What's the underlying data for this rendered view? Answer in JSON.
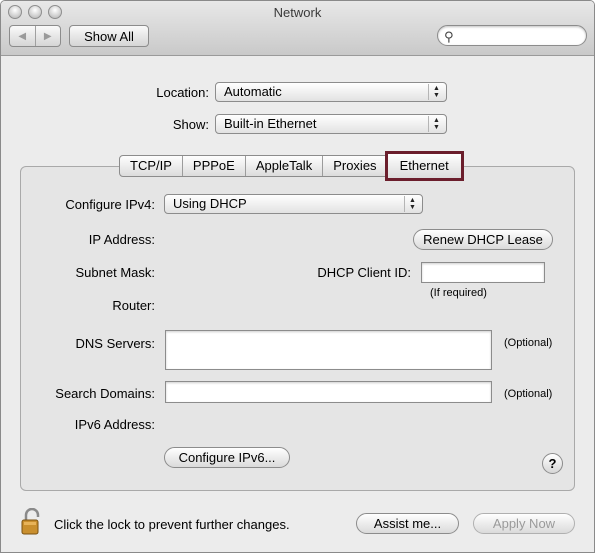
{
  "window": {
    "title": "Network"
  },
  "toolbar": {
    "show_all_label": "Show All",
    "search_placeholder": "",
    "back_glyph": "◀",
    "forward_glyph": "▶",
    "search_glyph": "⚲"
  },
  "location": {
    "label": "Location:",
    "value": "Automatic"
  },
  "show": {
    "label": "Show:",
    "value": "Built-in Ethernet"
  },
  "tabs": [
    {
      "label": "TCP/IP"
    },
    {
      "label": "PPPoE"
    },
    {
      "label": "AppleTalk"
    },
    {
      "label": "Proxies"
    },
    {
      "label": "Ethernet",
      "selected": true
    }
  ],
  "tcpip": {
    "configure_label": "Configure IPv4:",
    "configure_value": "Using DHCP",
    "ip_address_label": "IP Address:",
    "renew_button": "Renew DHCP Lease",
    "subnet_mask_label": "Subnet Mask:",
    "dhcp_client_id_label": "DHCP Client ID:",
    "dhcp_client_id_value": "",
    "if_required_note": "(If required)",
    "router_label": "Router:",
    "dns_servers_label": "DNS Servers:",
    "dns_servers_value": "",
    "optional_note": "(Optional)",
    "search_domains_label": "Search Domains:",
    "search_domains_value": "",
    "ipv6_address_label": "IPv6 Address:",
    "configure_ipv6_button": "Configure IPv6...",
    "help_glyph": "?"
  },
  "footer": {
    "lock_text": "Click the lock to prevent further changes.",
    "assist_button": "Assist me...",
    "apply_button": "Apply Now"
  },
  "colors": {
    "selected_tab_outline": "#6b1e2c"
  }
}
